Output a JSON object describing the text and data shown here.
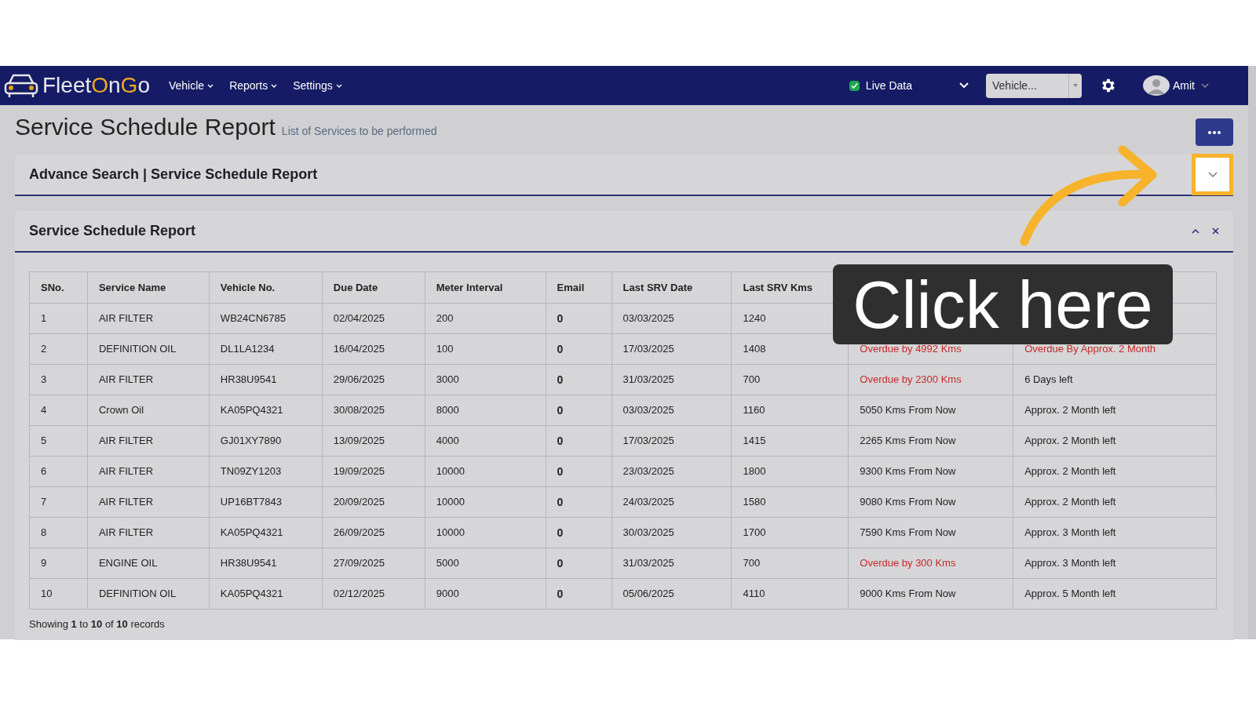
{
  "navbar": {
    "logo": [
      {
        "text": "Fleet",
        "accent": false
      },
      {
        "text": "O",
        "accent": true
      },
      {
        "text": "n",
        "accent": false
      },
      {
        "text": "G",
        "accent": true
      },
      {
        "text": "o",
        "accent": false
      }
    ],
    "menus": [
      "Vehicle",
      "Reports",
      "Settings"
    ],
    "live_data": {
      "label": "Live Data",
      "checked": true
    },
    "vehicle_select": {
      "placeholder": "Vehicle..."
    },
    "user": "Amit"
  },
  "page": {
    "title": "Service Schedule Report",
    "subtitle": "List of Services to be performed"
  },
  "advance_search": {
    "title": "Advance Search | Service Schedule Report",
    "expanded": false
  },
  "report": {
    "title": "Service Schedule Report",
    "columns": [
      "SNo.",
      "Service Name",
      "Vehicle No.",
      "Due Date",
      "Meter Interval",
      "Email",
      "Last SRV Date",
      "Last SRV Kms"
    ],
    "rows": [
      {
        "cells": [
          "1",
          "AIR FILTER",
          "WB24CN6785",
          "02/04/2025",
          "200",
          "0",
          "03/03/2025",
          "1240"
        ]
      },
      {
        "cells": [
          "2",
          "DEFINITION OIL",
          "DL1LA1234",
          "16/04/2025",
          "100",
          "0",
          "17/03/2025",
          "1408"
        ],
        "due_kms": {
          "text": "Overdue by 4992 Kms",
          "overdue": true
        },
        "time_left": {
          "text": "Overdue By Approx. 2 Month",
          "overdue": true
        }
      },
      {
        "cells": [
          "3",
          "AIR FILTER",
          "HR38U9541",
          "29/06/2025",
          "3000",
          "0",
          "31/03/2025",
          "700"
        ],
        "due_kms": {
          "text": "Overdue by 2300 Kms",
          "overdue": true
        },
        "time_left": {
          "text": "6 Days left",
          "overdue": false
        }
      },
      {
        "cells": [
          "4",
          "Crown Oil",
          "KA05PQ4321",
          "30/08/2025",
          "8000",
          "0",
          "03/03/2025",
          "1160"
        ],
        "due_kms": {
          "text": "5050 Kms From Now",
          "overdue": false
        },
        "time_left": {
          "text": "Approx. 2 Month left",
          "overdue": false
        }
      },
      {
        "cells": [
          "5",
          "AIR FILTER",
          "GJ01XY7890",
          "13/09/2025",
          "4000",
          "0",
          "17/03/2025",
          "1415"
        ],
        "due_kms": {
          "text": "2265 Kms From Now",
          "overdue": false
        },
        "time_left": {
          "text": "Approx. 2 Month left",
          "overdue": false
        }
      },
      {
        "cells": [
          "6",
          "AIR FILTER",
          "TN09ZY1203",
          "19/09/2025",
          "10000",
          "0",
          "23/03/2025",
          "1800"
        ],
        "due_kms": {
          "text": "9300 Kms From Now",
          "overdue": false
        },
        "time_left": {
          "text": "Approx. 2 Month left",
          "overdue": false
        }
      },
      {
        "cells": [
          "7",
          "AIR FILTER",
          "UP16BT7843",
          "20/09/2025",
          "10000",
          "0",
          "24/03/2025",
          "1580"
        ],
        "due_kms": {
          "text": "9080 Kms From Now",
          "overdue": false
        },
        "time_left": {
          "text": "Approx. 2 Month left",
          "overdue": false
        }
      },
      {
        "cells": [
          "8",
          "AIR FILTER",
          "KA05PQ4321",
          "26/09/2025",
          "10000",
          "0",
          "30/03/2025",
          "1700"
        ],
        "due_kms": {
          "text": "7590 Kms From Now",
          "overdue": false
        },
        "time_left": {
          "text": "Approx. 3 Month left",
          "overdue": false
        }
      },
      {
        "cells": [
          "9",
          "ENGINE OIL",
          "HR38U9541",
          "27/09/2025",
          "5000",
          "0",
          "31/03/2025",
          "700"
        ],
        "due_kms": {
          "text": "Overdue by 300 Kms",
          "overdue": true
        },
        "time_left": {
          "text": "Approx. 3 Month left",
          "overdue": false
        }
      },
      {
        "cells": [
          "10",
          "DEFINITION OIL",
          "KA05PQ4321",
          "02/12/2025",
          "9000",
          "0",
          "05/06/2025",
          "4110"
        ],
        "due_kms": {
          "text": "9000 Kms From Now",
          "overdue": false
        },
        "time_left": {
          "text": "Approx. 5 Month left",
          "overdue": false
        }
      }
    ],
    "footer": "Showing **1** to **10** of **10** records"
  },
  "callout": {
    "text": "Click here"
  }
}
